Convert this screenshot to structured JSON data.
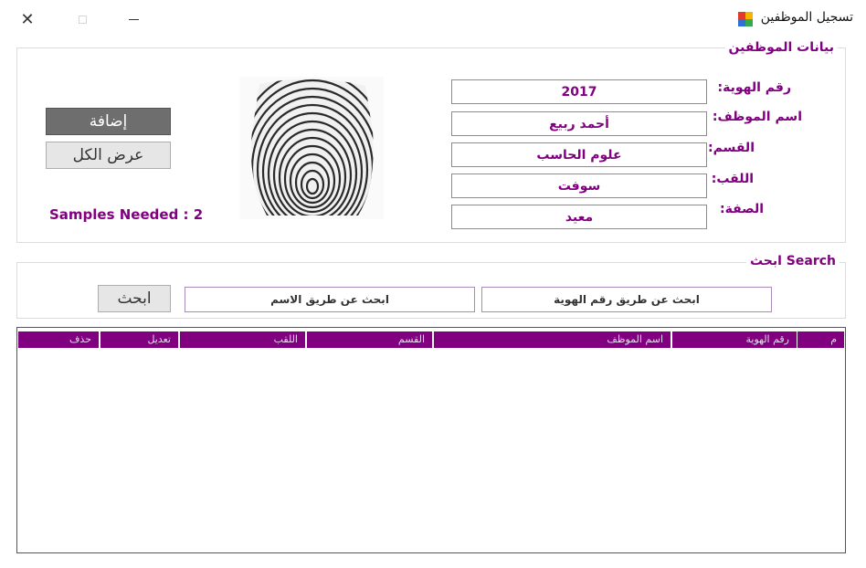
{
  "window": {
    "title": "تسجيل الموظفين",
    "close_glyph": "✕"
  },
  "employee_group": {
    "title": "بيانات الموظفين"
  },
  "fields": {
    "id": {
      "label": "رقم الهوية:",
      "value": "2017"
    },
    "name": {
      "label": "اسم الموظف:",
      "value": "أحمد ربيع"
    },
    "department": {
      "label": "القسم:",
      "value": "علوم الحاسب"
    },
    "title": {
      "label": "اللقب:",
      "value": "سوفت"
    },
    "position": {
      "label": "الصفة:",
      "value": "معيد"
    }
  },
  "buttons": {
    "add": "إضافة",
    "show_all": "عرض الكل",
    "search": "ابحث"
  },
  "samples_needed": "Samples Needed : 2",
  "search_group": {
    "title": "ابحث Search",
    "by_name": "ابحث عن طريق الاسم",
    "by_id": "ابحث عن طريق رقم الهوية"
  },
  "grid": {
    "columns": [
      "م",
      "رقم الهوية",
      "اسم الموظف",
      "القسم",
      "اللقب",
      "تعديل",
      "حذف"
    ],
    "header_color": "#800080"
  },
  "colors": {
    "accent": "#800080"
  }
}
